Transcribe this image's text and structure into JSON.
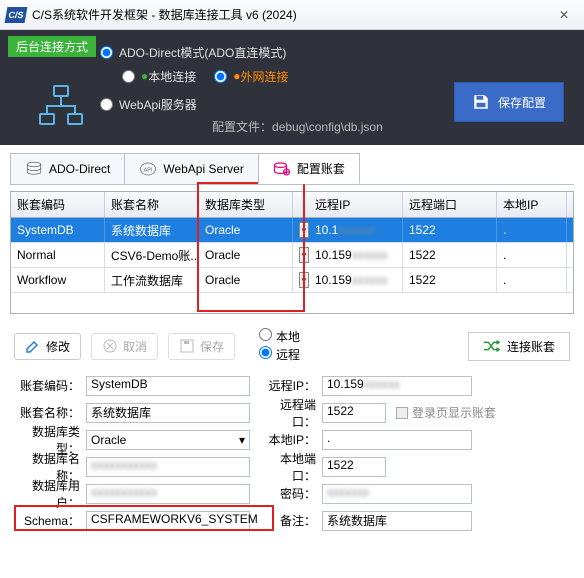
{
  "titlebar": {
    "logo": "C/S",
    "title": "C/S系统软件开发框架 - 数据库连接工具 v6 (2024)"
  },
  "dark": {
    "conn_method_label": "后台连接方式",
    "ado_direct": "ADO-Direct模式(ADO直连模式)",
    "local": "本地连接",
    "wan": "外网连接",
    "webapi": "WebApi服务器",
    "cfg_label": "配置文件：",
    "cfg_path": "debug\\config\\db.json",
    "save_btn": "保存配置"
  },
  "tabs": {
    "ado": "ADO-Direct",
    "webapi": "WebApi Server",
    "config": "配置账套"
  },
  "table": {
    "headers": [
      "账套编码",
      "账套名称",
      "数据库类型",
      "",
      "远程IP",
      "远程端口",
      "本地IP"
    ],
    "rows": [
      {
        "code": "SystemDB",
        "name": "系统数据库",
        "dbtype": "Oracle",
        "ip": "10.1",
        "port": "1522",
        "local": "."
      },
      {
        "code": "Normal",
        "name": "CSV6-Demo账...",
        "dbtype": "Oracle",
        "ip": "10.159",
        "port": "1522",
        "local": "."
      },
      {
        "code": "Workflow",
        "name": "工作流数据库",
        "dbtype": "Oracle",
        "ip": "10.159",
        "port": "1522",
        "local": "."
      }
    ]
  },
  "toolbar2": {
    "edit": "修改",
    "cancel": "取消",
    "save": "保存",
    "local": "本地",
    "remote": "远程",
    "connect": "连接账套"
  },
  "form": {
    "code_label": "账套编码：",
    "code": "SystemDB",
    "name_label": "账套名称：",
    "name": "系统数据库",
    "dbtype_label": "数据库类型：",
    "dbtype": "Oracle",
    "dbname_label": "数据库名称：",
    "dbname": "",
    "dbuser_label": "数据库用户：",
    "dbuser": "",
    "schema_label": "Schema：",
    "schema": "CSFRAMEWORKV6_SYSTEM",
    "rip_label": "远程IP：",
    "rip": "10.159",
    "rport_label": "远程端口：",
    "rport": "1522",
    "lip_label": "本地IP：",
    "lip": ".",
    "lport_label": "本地端口：",
    "lport": "1522",
    "pwd_label": "密码：",
    "pwd": "",
    "note_label": "备注：",
    "note": "系统数据库",
    "show_on_login": "登录页显示账套"
  }
}
